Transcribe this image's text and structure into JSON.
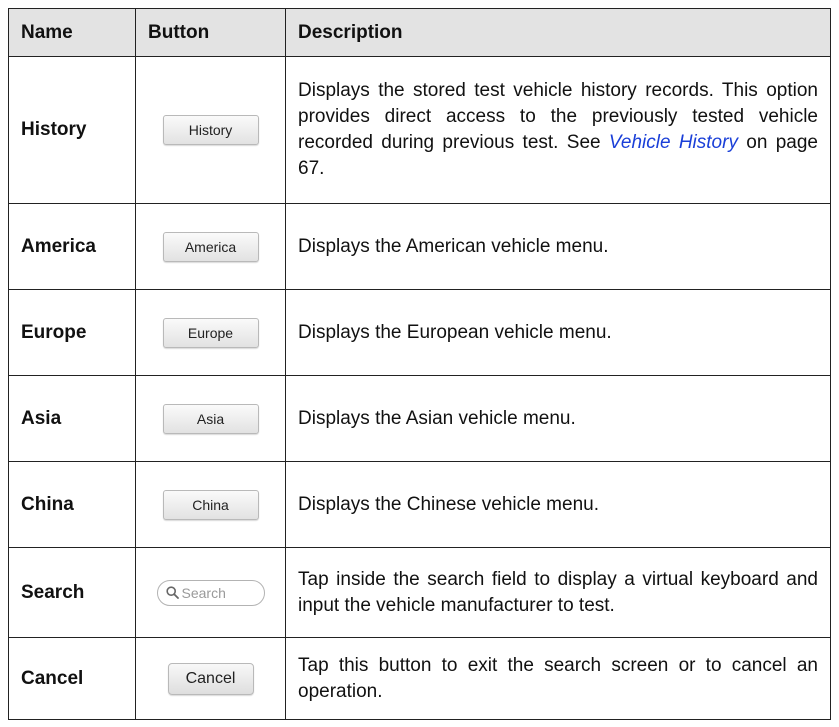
{
  "table": {
    "headers": {
      "name": "Name",
      "button": "Button",
      "description": "Description"
    },
    "rows": [
      {
        "name": "History",
        "button_label": "History",
        "description": "Displays the stored test vehicle history records. This option provides direct access to the previously tested vehicle recorded during previous test.",
        "desc_see": "See",
        "desc_link": "Vehicle History",
        "desc_after": "on page 67."
      },
      {
        "name": "America",
        "button_label": "America",
        "description": "Displays the American vehicle menu."
      },
      {
        "name": "Europe",
        "button_label": "Europe",
        "description": "Displays the European vehicle menu."
      },
      {
        "name": "Asia",
        "button_label": "Asia",
        "description": "Displays the Asian vehicle menu."
      },
      {
        "name": "China",
        "button_label": "China",
        "description": "Displays the Chinese vehicle menu."
      },
      {
        "name": "Search",
        "button_placeholder": "Search",
        "icon": "search-icon",
        "description": "Tap inside the search field to display a virtual keyboard and input the vehicle manufacturer to test."
      },
      {
        "name": "Cancel",
        "button_label": "Cancel",
        "description": "Tap this button to exit the search screen or to cancel an operation."
      }
    ]
  },
  "colors": {
    "header_bg": "#e3e3e3",
    "border": "#222222",
    "link": "#1a3fd8"
  }
}
